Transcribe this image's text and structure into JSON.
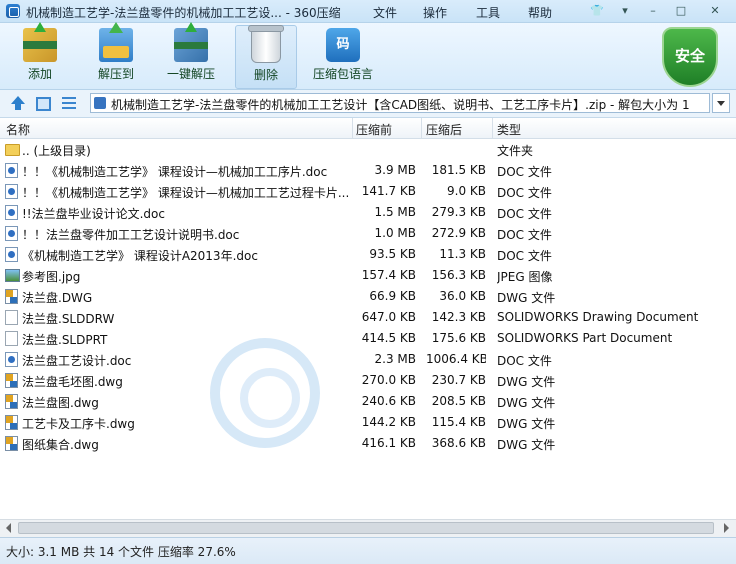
{
  "window": {
    "title": "机械制造工艺学-法兰盘零件的机械加工工艺设... - 360压缩",
    "menu": [
      "文件",
      "操作",
      "工具",
      "帮助"
    ]
  },
  "toolbar": {
    "buttons": [
      {
        "label": "添加",
        "icon": "add-archive-icon"
      },
      {
        "label": "解压到",
        "icon": "extract-to-icon"
      },
      {
        "label": "一键解压",
        "icon": "one-click-extract-icon"
      },
      {
        "label": "删除",
        "icon": "trash-icon"
      },
      {
        "label": "压缩包语言",
        "icon": "archive-language-icon"
      }
    ],
    "lang_glyph": "码",
    "shield_label": "安全"
  },
  "address": {
    "path": "机械制造工艺学-法兰盘零件的机械加工工艺设计【含CAD图纸、说明书、工艺工序卡片】.zip - 解包大小为 1"
  },
  "columns": {
    "name": "名称",
    "compressed": "压缩前",
    "after": "压缩后",
    "type": "类型"
  },
  "files": [
    {
      "name": ".. (上级目录)",
      "size": "",
      "comp": "",
      "type": "文件夹",
      "icon": "folder"
    },
    {
      "name": "！！《机械制造工艺学》 课程设计—机械加工工序片.doc",
      "size": "3.9 MB",
      "comp": "181.5 KB",
      "type": "DOC 文件",
      "icon": "doc"
    },
    {
      "name": "！！《机械制造工艺学》 课程设计—机械加工工艺过程卡片...",
      "size": "141.7 KB",
      "comp": "9.0 KB",
      "type": "DOC 文件",
      "icon": "doc"
    },
    {
      "name": "!!法兰盘毕业设计论文.doc",
      "size": "1.5 MB",
      "comp": "279.3 KB",
      "type": "DOC 文件",
      "icon": "doc"
    },
    {
      "name": "！！法兰盘零件加工工艺设计说明书.doc",
      "size": "1.0 MB",
      "comp": "272.9 KB",
      "type": "DOC 文件",
      "icon": "doc"
    },
    {
      "name": "《机械制造工艺学》 课程设计A2013年.doc",
      "size": "93.5 KB",
      "comp": "11.3 KB",
      "type": "DOC 文件",
      "icon": "doc"
    },
    {
      "name": "参考图.jpg",
      "size": "157.4 KB",
      "comp": "156.3 KB",
      "type": "JPEG 图像",
      "icon": "img"
    },
    {
      "name": "法兰盘.DWG",
      "size": "66.9 KB",
      "comp": "36.0 KB",
      "type": "DWG 文件",
      "icon": "dwg"
    },
    {
      "name": "法兰盘.SLDDRW",
      "size": "647.0 KB",
      "comp": "142.3 KB",
      "type": "SOLIDWORKS Drawing Document",
      "icon": "blank"
    },
    {
      "name": "法兰盘.SLDPRT",
      "size": "414.5 KB",
      "comp": "175.6 KB",
      "type": "SOLIDWORKS Part Document",
      "icon": "blank"
    },
    {
      "name": "法兰盘工艺设计.doc",
      "size": "2.3 MB",
      "comp": "1006.4 KB",
      "type": "DOC 文件",
      "icon": "doc"
    },
    {
      "name": "法兰盘毛坯图.dwg",
      "size": "270.0 KB",
      "comp": "230.7 KB",
      "type": "DWG 文件",
      "icon": "dwg"
    },
    {
      "name": "法兰盘图.dwg",
      "size": "240.6 KB",
      "comp": "208.5 KB",
      "type": "DWG 文件",
      "icon": "dwg"
    },
    {
      "name": "工艺卡及工序卡.dwg",
      "size": "144.2 KB",
      "comp": "115.4 KB",
      "type": "DWG 文件",
      "icon": "dwg"
    },
    {
      "name": "图纸集合.dwg",
      "size": "416.1 KB",
      "comp": "368.6 KB",
      "type": "DWG 文件",
      "icon": "dwg"
    }
  ],
  "status": {
    "text": "大小: 3.1 MB 共 14 个文件 压缩率 27.6%"
  }
}
